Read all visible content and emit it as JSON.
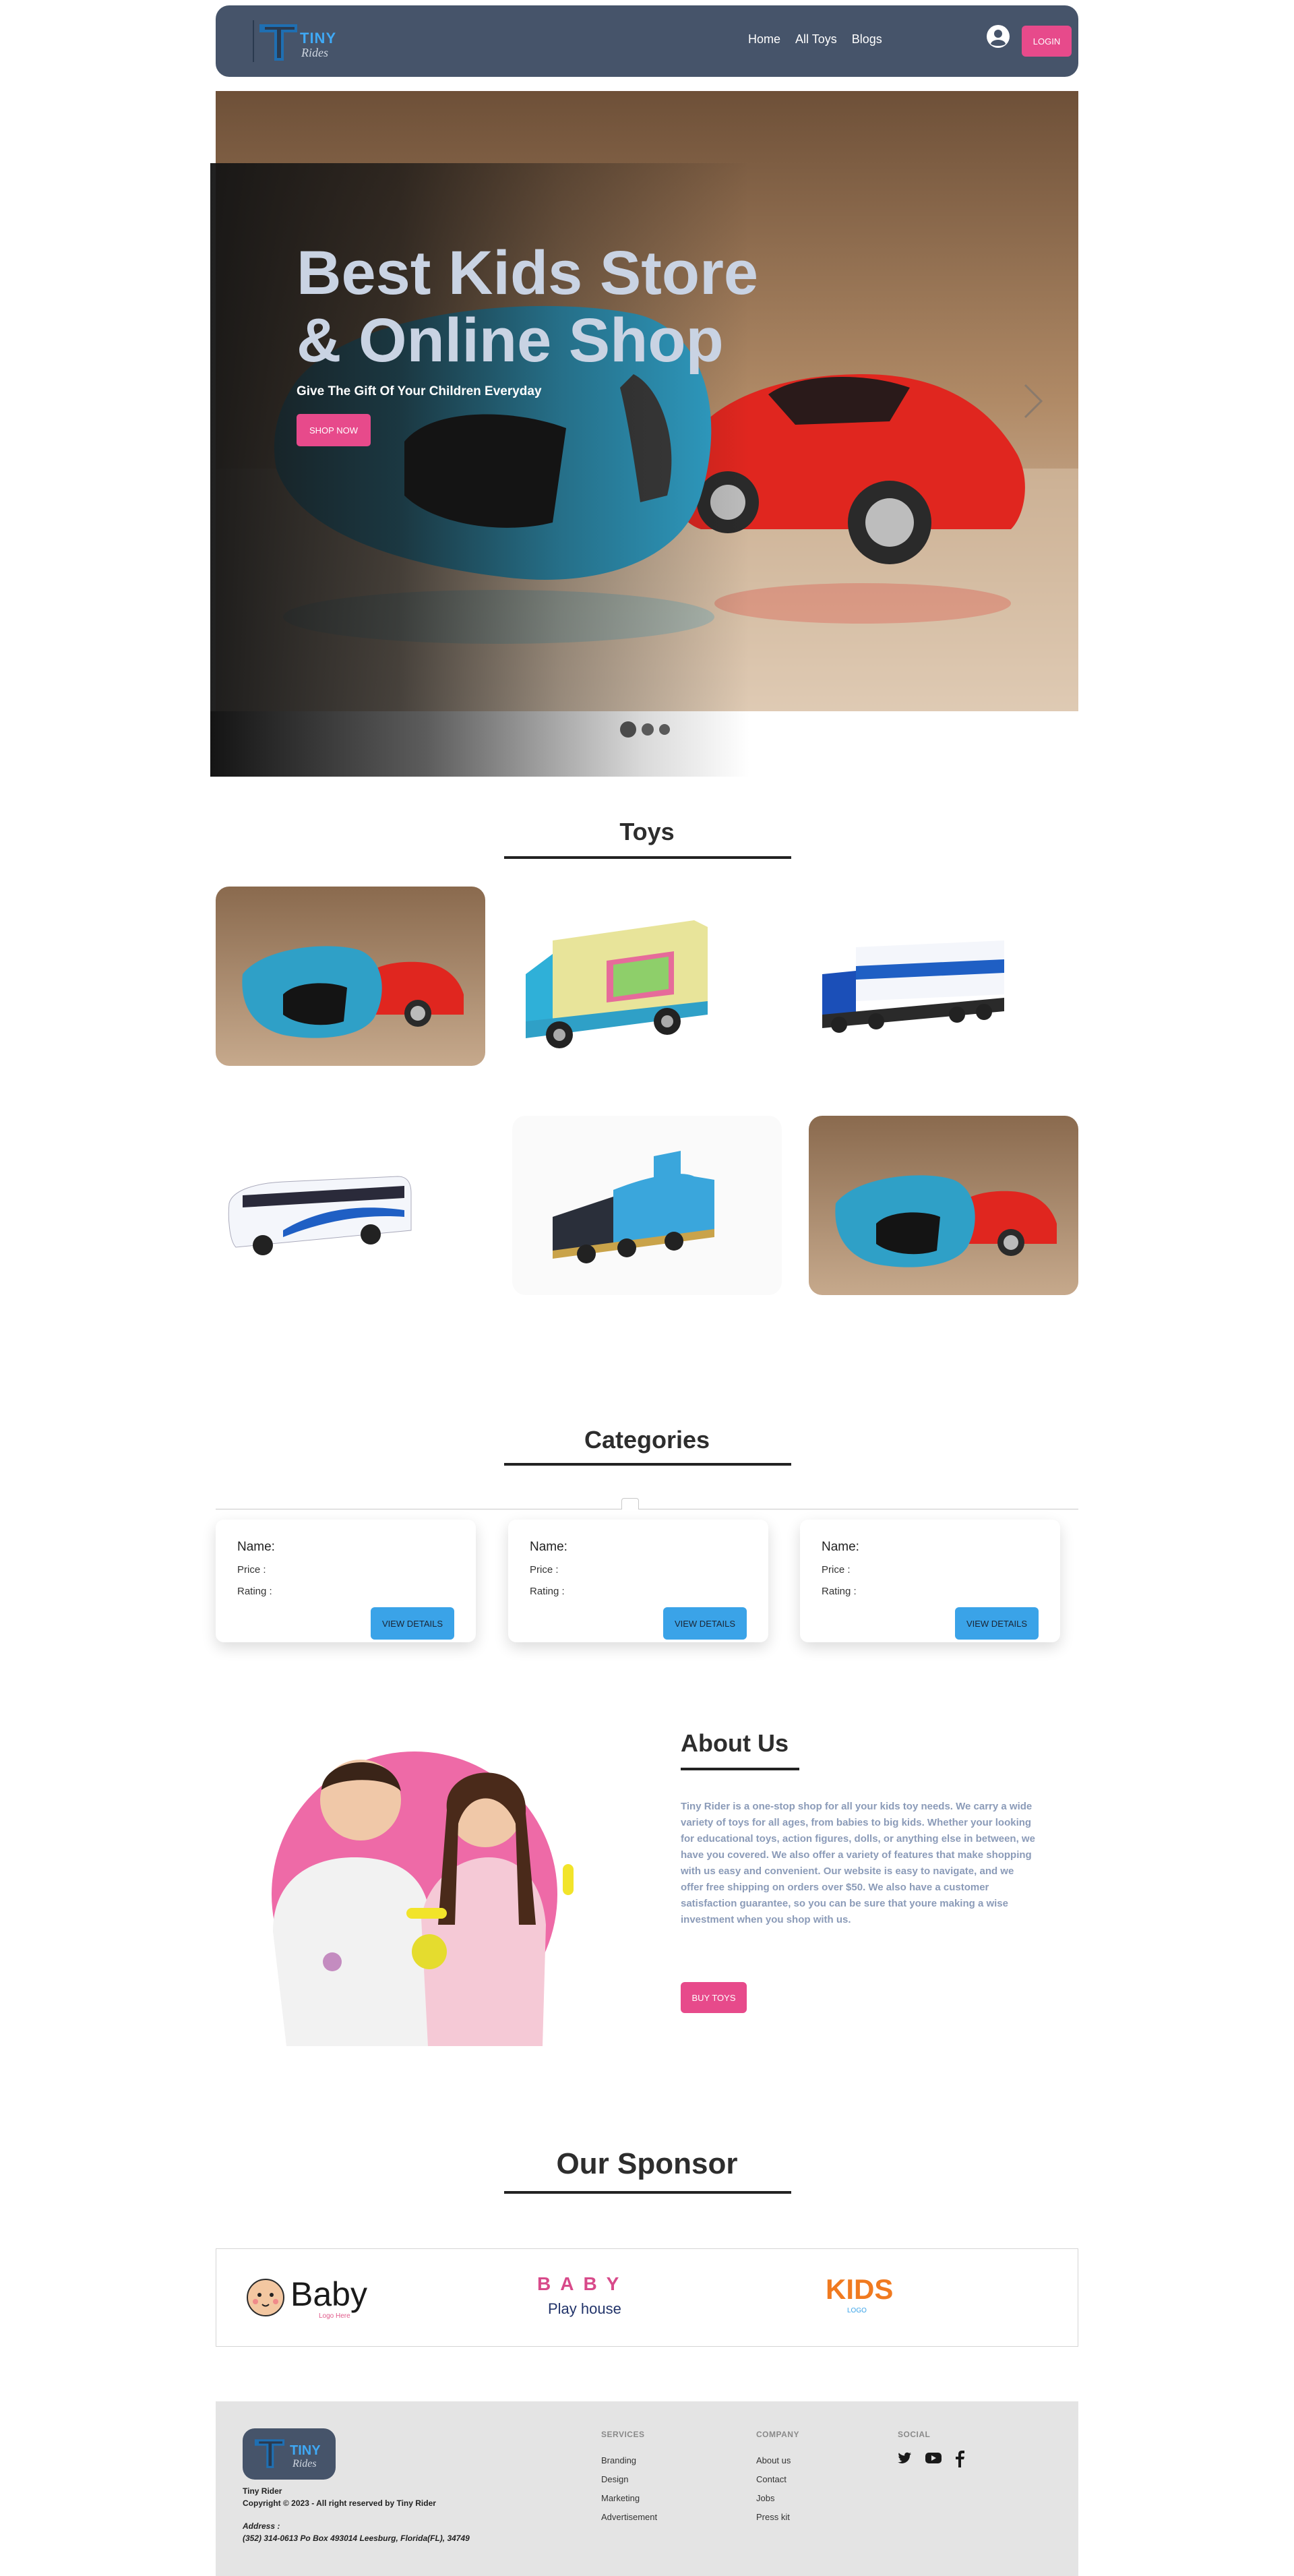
{
  "brand": {
    "tiny": "TINY",
    "rides": "Rides"
  },
  "nav": {
    "links": [
      "Home",
      "All Toys",
      "Blogs"
    ],
    "login": "LOGIN"
  },
  "hero": {
    "title_line1": "Best Kids Store",
    "title_line2": "& Online Shop",
    "subtitle": "Give The Gift Of Your Children Everyday",
    "cta": "SHOP NOW",
    "slide_dots": 3,
    "active_slide": 1
  },
  "toys": {
    "title": "Toys",
    "items": [
      "crashed-toy-cars",
      "ice-cream-truck",
      "freight-truck",
      "tour-bus",
      "steam-locomotive",
      "crashed-toy-cars"
    ]
  },
  "categories": {
    "title": "Categories",
    "cards": [
      {
        "name": "Name:",
        "price": "Price :",
        "rating": "Rating :",
        "button": "VIEW DETAILS"
      },
      {
        "name": "Name:",
        "price": "Price :",
        "rating": "Rating :",
        "button": "VIEW DETAILS"
      },
      {
        "name": "Name:",
        "price": "Price :",
        "rating": "Rating :",
        "button": "VIEW DETAILS"
      }
    ]
  },
  "about": {
    "title": "About Us",
    "text": "Tiny Rider is a one-stop shop for all your kids toy needs. We carry a wide variety of toys for all ages, from babies to big kids. Whether your looking for educational toys, action figures, dolls, or anything else in between, we have you covered. We also offer a variety of features that make shopping with us easy and convenient. Our website is easy to navigate, and we offer free shipping on orders over $50. We also have a customer satisfaction guarantee, so you can be sure that youre making a wise investment when you shop with us.",
    "button": "BUY TOYS"
  },
  "sponsor": {
    "title": "Our Sponsor",
    "logos": [
      {
        "text": "Baby",
        "tagline": "Logo Here"
      },
      {
        "line1": "BABY",
        "line2": "Play house"
      },
      {
        "text": "KIDS",
        "tagline": "LOGO"
      }
    ]
  },
  "footer": {
    "brand_name": "Tiny Rider",
    "copyright": "Copyright © 2023 - All right reserved by Tiny Rider",
    "address_label": "Address :",
    "address": "(352) 314-0613 Po Box 493014 Leesburg, Florida(FL), 34749",
    "services": {
      "heading": "SERVICES",
      "links": [
        "Branding",
        "Design",
        "Marketing",
        "Advertisement"
      ]
    },
    "company": {
      "heading": "COMPANY",
      "links": [
        "About us",
        "Contact",
        "Jobs",
        "Press kit"
      ]
    },
    "social": {
      "heading": "SOCIAL",
      "icons": [
        "twitter-icon",
        "youtube-icon",
        "facebook-icon"
      ]
    }
  },
  "colors": {
    "nav_bg": "#46546a",
    "accent_pink": "#e74a8b",
    "accent_blue": "#3aa3e8",
    "footer_bg": "#e4e4e4"
  }
}
